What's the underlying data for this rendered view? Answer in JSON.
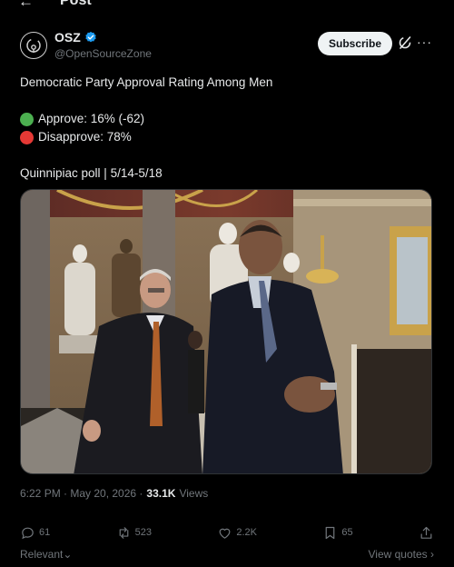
{
  "header": {
    "back_icon": "arrow-left-icon",
    "title": "Post"
  },
  "author": {
    "name": "OSZ",
    "handle": "@OpenSourceZone",
    "verified": true,
    "subscribe_label": "Subscribe"
  },
  "post": {
    "headline": "Democratic Party Approval Rating Among Men",
    "approve": {
      "text": "Approve: 16% (-62)",
      "color": "#4caf50"
    },
    "disapprove": {
      "text": "Disapprove: 78%",
      "color": "#e53935"
    },
    "source": "Quinnipiac poll | 5/14-5/18"
  },
  "meta": {
    "timestamp": "6:22 PM · May 20, 2026 ·",
    "views_count": "33.1K",
    "views_label": "Views"
  },
  "actions": {
    "replies": "61",
    "reposts": "523",
    "likes": "2.2K",
    "bookmarks": "65"
  },
  "footer": {
    "sort_label": "Relevant",
    "view_quotes_label": "View quotes"
  },
  "colors": {
    "accent": "#1d9bf0",
    "muted": "#71767b",
    "text": "#e7e9ea"
  }
}
